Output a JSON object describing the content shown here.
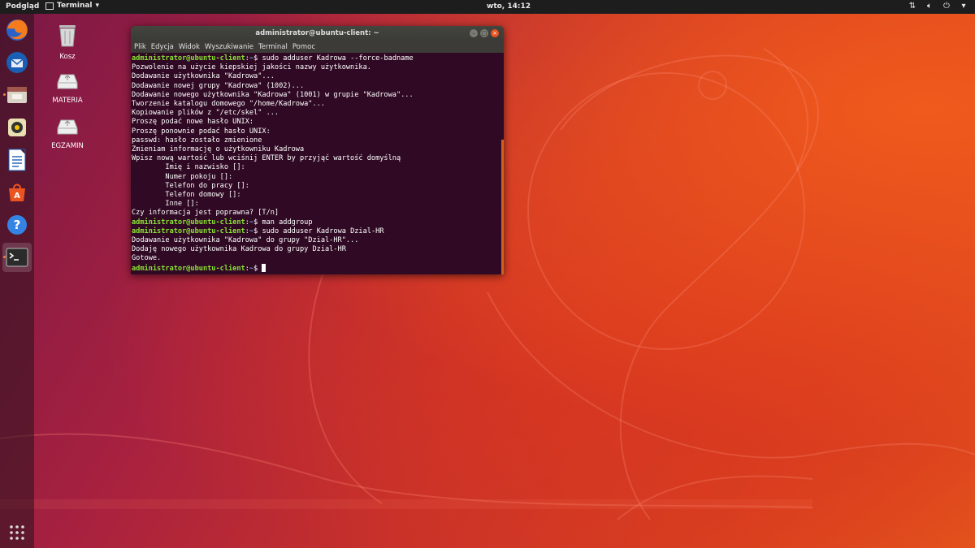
{
  "topbar": {
    "activities": "Podgląd",
    "app_menu": "Terminal",
    "clock": "wto, 14:12",
    "tray_icons": [
      "network-icon",
      "volume-icon",
      "power-icon"
    ]
  },
  "dock": {
    "items": [
      "firefox-icon",
      "thunderbird-icon",
      "files-icon",
      "rhythmbox-icon",
      "libreoffice-writer-icon",
      "software-center-icon",
      "help-icon",
      "terminal-icon",
      "show-applications-icon"
    ]
  },
  "desktop": {
    "icons": [
      {
        "label": "Kosz",
        "icon": "trash-icon"
      },
      {
        "label": "MATERIA",
        "icon": "drive-icon"
      },
      {
        "label": "EGZAMIN",
        "icon": "drive-icon"
      }
    ]
  },
  "terminal": {
    "title": "administrator@ubuntu-client: ~",
    "menu": [
      "Plik",
      "Edycja",
      "Widok",
      "Wyszukiwanie",
      "Terminal",
      "Pomoc"
    ],
    "prompt_user": "administrator@ubuntu-client",
    "prompt_path": "~",
    "lines": [
      {
        "type": "cmd",
        "text": "sudo adduser Kadrowa --force-badname"
      },
      {
        "type": "out",
        "text": "Pozwolenie na użycie kiepskiej jakości nazwy użytkownika."
      },
      {
        "type": "out",
        "text": "Dodawanie użytkownika \"Kadrowa\"..."
      },
      {
        "type": "out",
        "text": "Dodawanie nowej grupy \"Kadrowa\" (1002)..."
      },
      {
        "type": "out",
        "text": "Dodawanie nowego użytkownika \"Kadrowa\" (1001) w grupie \"Kadrowa\"..."
      },
      {
        "type": "out",
        "text": "Tworzenie katalogu domowego \"/home/Kadrowa\"..."
      },
      {
        "type": "out",
        "text": "Kopiowanie plików z \"/etc/skel\" ..."
      },
      {
        "type": "out",
        "text": "Proszę podać nowe hasło UNIX:"
      },
      {
        "type": "out",
        "text": "Proszę ponownie podać hasło UNIX:"
      },
      {
        "type": "out",
        "text": "passwd: hasło zostało zmienione"
      },
      {
        "type": "out",
        "text": "Zmieniam informację o użytkowniku Kadrowa"
      },
      {
        "type": "out",
        "text": "Wpisz nową wartość lub wciśnij ENTER by przyjąć wartość domyślną"
      },
      {
        "type": "out",
        "text": "        Imię i nazwisko []:"
      },
      {
        "type": "out",
        "text": "        Numer pokoju []:"
      },
      {
        "type": "out",
        "text": "        Telefon do pracy []:"
      },
      {
        "type": "out",
        "text": "        Telefon domowy []:"
      },
      {
        "type": "out",
        "text": "        Inne []:"
      },
      {
        "type": "out",
        "text": "Czy informacja jest poprawna? [T/n]"
      },
      {
        "type": "cmd",
        "text": "man addgroup"
      },
      {
        "type": "cmd",
        "text": "sudo adduser Kadrowa Dzial-HR"
      },
      {
        "type": "out",
        "text": "Dodawanie użytkownika \"Kadrowa\" do grupy \"Dzial-HR\"..."
      },
      {
        "type": "out",
        "text": "Dodaję nowego użytkownika Kadrowa do grupy Dzial-HR"
      },
      {
        "type": "out",
        "text": "Gotowe."
      },
      {
        "type": "prompt",
        "text": ""
      }
    ]
  },
  "colors": {
    "ubuntu_orange": "#e95420",
    "terminal_bg": "#300a24",
    "prompt_green": "#8ae234",
    "path_blue": "#729fcf"
  }
}
